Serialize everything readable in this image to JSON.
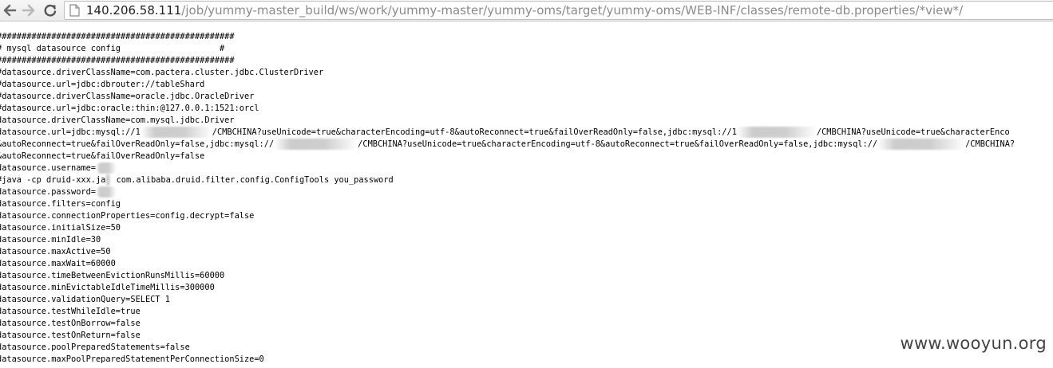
{
  "browser": {
    "back_icon": "back-arrow-icon",
    "forward_icon": "forward-arrow-icon",
    "reload_icon": "reload-icon",
    "page_icon": "page-document-icon",
    "url_host": "140.206.58.111",
    "url_path": "/job/yummy-master_build/ws/work/yummy-master/yummy-oms/target/yummy-oms/WEB-INF/classes/remote-db.properties/*view*/"
  },
  "file": {
    "lines": [
      "################################################",
      "# mysql datasource config                    #",
      "################################################",
      "#datasource.driverClassName=com.pactera.cluster.jdbc.ClusterDriver",
      "#datasource.url=jdbc:dbrouter://tableShard",
      "#datasource.driverClassName=oracle.jdbc.OracleDriver",
      "#datasource.url=jdbc:oracle:thin:@127.0.0.1:1521:orcl",
      "datasource.driverClassName=com.mysql.jdbc.Driver"
    ],
    "url_line1": {
      "a": "datasource.url=jdbc:mysql://1",
      "b": "/CMBCHINA?useUnicode=true&characterEncoding=utf-8&autoReconnect=true&failOverReadOnly=false,jdbc:mysql://1",
      "c": "/CMBCHINA?useUnicode=true&characterEnco"
    },
    "url_line2": {
      "a": "&autoReconnect=true&failOverReadOnly=false,jdbc:mysql://",
      "b": "/CMBCHINA?useUnicode=true&characterEncoding=utf-8&autoReconnect=true&failOverReadOnly=false,jdbc:mysql://",
      "c": "/CMBCHINA?"
    },
    "url_line3": "&autoReconnect=true&failOverReadOnly=false",
    "username_line": "datasource.username=",
    "java_line_a": "#java -cp druid-xxx.ja",
    "java_line_b": " com.alibaba.druid.filter.config.ConfigTools you_password",
    "password_line": "datasource.password=",
    "tail_lines": [
      "datasource.filters=config",
      "datasource.connectionProperties=config.decrypt=false",
      "datasource.initialSize=50",
      "datasource.minIdle=30",
      "datasource.maxActive=50",
      "datasource.maxWait=60000",
      "datasource.timeBetweenEvictionRunsMillis=60000",
      "datasource.minEvictableIdleTimeMillis=300000",
      "datasource.validationQuery=SELECT 1",
      "datasource.testWhileIdle=true",
      "datasource.testOnBorrow=false",
      "datasource.testOnReturn=false",
      "datasource.poolPreparedStatements=false",
      "datasource.maxPoolPreparedStatementPerConnectionSize=0"
    ]
  },
  "watermark": "www.wooyun.org"
}
